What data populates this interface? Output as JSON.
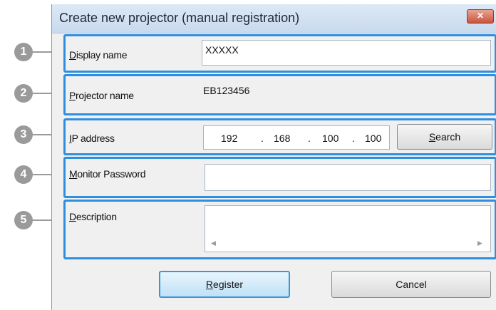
{
  "dialog": {
    "title": "Create new projector (manual registration)",
    "close_label": "✕"
  },
  "callouts": [
    "1",
    "2",
    "3",
    "4",
    "5"
  ],
  "fields": {
    "display_name": {
      "label_accel": "D",
      "label_rest": "isplay name",
      "value": "XXXXX"
    },
    "projector_name": {
      "label_accel": "P",
      "label_rest": "rojector name",
      "value": "EB123456"
    },
    "ip_address": {
      "label_accel": "I",
      "label_rest": "P address",
      "octets": [
        "192",
        "168",
        "100",
        "100"
      ],
      "separator": "."
    },
    "monitor_password": {
      "label_accel": "M",
      "label_rest": "onitor Password",
      "value": ""
    },
    "description": {
      "label_accel": "D",
      "label_rest": "escription",
      "value": "",
      "scroll_left": "◀",
      "scroll_right": "▶"
    }
  },
  "buttons": {
    "search": {
      "accel": "S",
      "rest": "earch"
    },
    "register": {
      "accel": "R",
      "rest": "egister"
    },
    "cancel": {
      "label": "Cancel"
    }
  },
  "colors": {
    "highlight": "#2e8fe0",
    "callout": "#9a9a9a"
  }
}
